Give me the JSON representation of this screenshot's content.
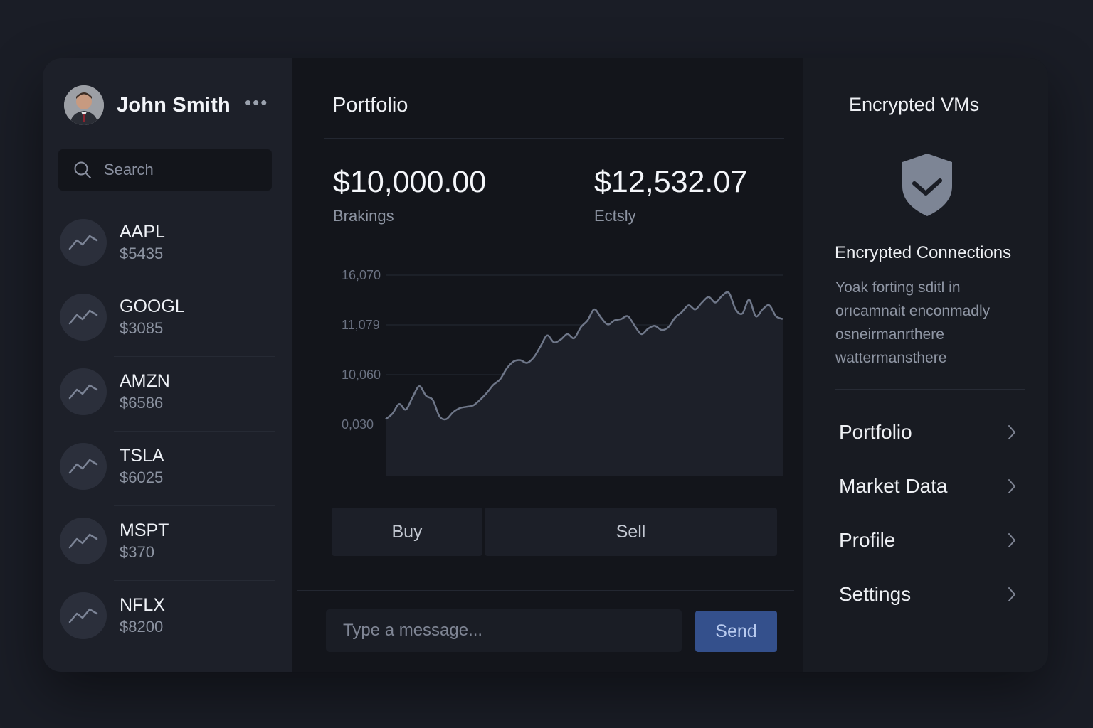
{
  "user": {
    "name": "John Smith",
    "more_icon": "more-horizontal-icon"
  },
  "search": {
    "placeholder": "Search"
  },
  "stocks": [
    {
      "ticker": "AAPL",
      "price": "$5435"
    },
    {
      "ticker": "GOOGL",
      "price": "$3085"
    },
    {
      "ticker": "AMZN",
      "price": "$6586"
    },
    {
      "ticker": "TSLA",
      "price": "$6025"
    },
    {
      "ticker": "MSPT",
      "price": "$370"
    },
    {
      "ticker": "NFLX",
      "price": "$8200"
    }
  ],
  "main": {
    "title": "Portfolio",
    "stats": [
      {
        "value": "$10,000.00",
        "label": "Brakings"
      },
      {
        "value": "$12,532.07",
        "label": "Ectsly"
      }
    ],
    "buy_label": "Buy",
    "sell_label": "Sell",
    "message_placeholder": "Type a message...",
    "send_label": "Send"
  },
  "chart_data": {
    "type": "line",
    "y_tick_labels": [
      "16,070",
      "11,079",
      "10,060",
      "0,030"
    ],
    "x": [
      0,
      1,
      2,
      3,
      4,
      5,
      6,
      7,
      8,
      9,
      10,
      11,
      12,
      13,
      14,
      15,
      16,
      17,
      18,
      19,
      20,
      21,
      22,
      23,
      24,
      25,
      26,
      27,
      28,
      29,
      30,
      31,
      32,
      33,
      34,
      35,
      36,
      37,
      38,
      39,
      40,
      41,
      42,
      43,
      44,
      45,
      46,
      47,
      48,
      49,
      50,
      51,
      52,
      53,
      54,
      55,
      56,
      57,
      58,
      59
    ],
    "values": [
      0.08,
      0.12,
      0.19,
      0.15,
      0.24,
      0.32,
      0.25,
      0.22,
      0.1,
      0.08,
      0.13,
      0.16,
      0.17,
      0.18,
      0.22,
      0.27,
      0.33,
      0.37,
      0.45,
      0.5,
      0.51,
      0.49,
      0.53,
      0.61,
      0.69,
      0.64,
      0.66,
      0.7,
      0.67,
      0.75,
      0.8,
      0.88,
      0.82,
      0.77,
      0.8,
      0.81,
      0.83,
      0.76,
      0.7,
      0.74,
      0.76,
      0.73,
      0.75,
      0.82,
      0.86,
      0.91,
      0.88,
      0.93,
      0.97,
      0.93,
      0.98,
      1.0,
      0.88,
      0.85,
      0.95,
      0.83,
      0.88,
      0.91,
      0.83,
      0.81
    ],
    "grid": true,
    "colors": {
      "line": "#6f7789",
      "fill": "#1d2029",
      "grid": "#262a34"
    }
  },
  "right": {
    "title": "Encrypted VMs",
    "shield_icon": "shield-check-icon",
    "enc_title": "Encrypted Connections",
    "enc_desc_lines": [
      "Yoak forting sditl in",
      "orıcamnait enconmadly",
      "osneirmanrthere",
      "wattermansthere"
    ],
    "nav": [
      {
        "label": "Portfolio"
      },
      {
        "label": "Market Data"
      },
      {
        "label": "Profile"
      },
      {
        "label": "Settings"
      }
    ]
  },
  "colors": {
    "accent": "#34508c",
    "background": "#1a1d26",
    "sidebar": "#1d2029"
  }
}
